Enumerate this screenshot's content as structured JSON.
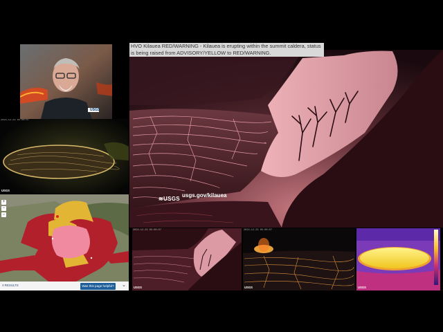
{
  "alert": {
    "text": "HVO Kilauea RED/WARNING - Kilauea is erupting within the summit caldera, status is being raised from ADVISORY/YELLOW to RED/WARNING."
  },
  "presenter": {
    "badge": "USGS"
  },
  "cams": {
    "aerial_timestamp": "2024-12-23 05:00:07",
    "main_watermark": "USGS",
    "main_url": "usgs.gov/kilauea",
    "small1_label": "USGS",
    "small2_label": "USGS",
    "thermal_label": "USGS",
    "small1_timestamp": "2024-12-23 05:00:07",
    "small2_timestamp": "2024-12-23 05:00:07"
  },
  "map": {
    "results_label": "RESULTS",
    "help_button": "Was this page helpful?",
    "chevron": "chevron-down-icon"
  },
  "colors": {
    "lava_pink": "#f08aa0",
    "flow_red": "#b2202c",
    "flow_yellow": "#e2b534",
    "button_blue": "#1f5f99"
  }
}
